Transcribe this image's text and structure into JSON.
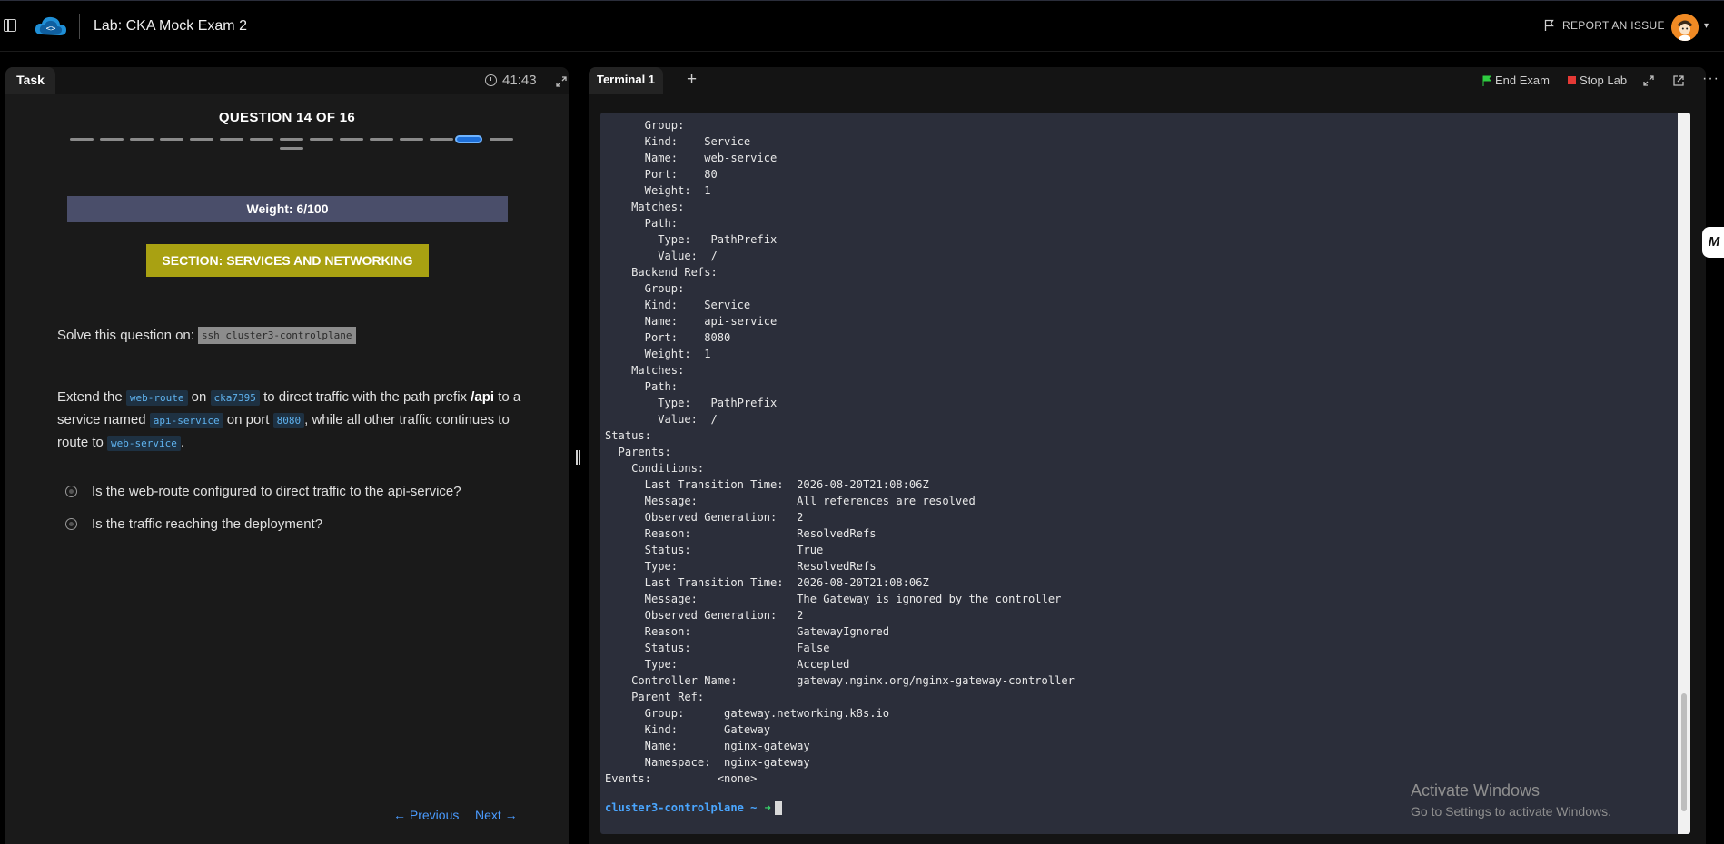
{
  "header": {
    "lab_title": "Lab: CKA Mock Exam 2",
    "report_label": "REPORT AN ISSUE"
  },
  "task_panel": {
    "tab_label": "Task",
    "timer": "41:43",
    "question_title": "QUESTION 14 OF 16",
    "progress": {
      "total": 16,
      "current": 14
    },
    "weight": "Weight: 6/100",
    "section": "SECTION: SERVICES AND NETWORKING",
    "solve_prefix": "Solve this question on:",
    "solve_command": "ssh cluster3-controlplane",
    "desc": {
      "t1": "Extend the",
      "c1": "web-route",
      "t2": "on",
      "c2": "cka7395",
      "t3": "to direct traffic with the path prefix",
      "b1": "/api",
      "t4": "to a service named",
      "c3": "api-service",
      "t5": "on port",
      "c4": "8080",
      "t6": ", while all other traffic continues to route to",
      "c5": "web-service",
      "t7": "."
    },
    "checks": [
      {
        "label": "Is the web-route configured to direct traffic to the api-service?"
      },
      {
        "label": "Is the traffic reaching the deployment?"
      }
    ],
    "prev_label": "← Previous",
    "next_label": "Next →"
  },
  "terminal_panel": {
    "tab_label": "Terminal 1",
    "add_tab_label": "+",
    "end_exam_label": "End Exam",
    "stop_lab_label": "Stop Lab",
    "lines": [
      "      Group:",
      "      Kind:    Service",
      "      Name:    web-service",
      "      Port:    80",
      "      Weight:  1",
      "    Matches:",
      "      Path:",
      "        Type:   PathPrefix",
      "        Value:  /",
      "    Backend Refs:",
      "      Group:",
      "      Kind:    Service",
      "      Name:    api-service",
      "      Port:    8080",
      "      Weight:  1",
      "    Matches:",
      "      Path:",
      "        Type:   PathPrefix",
      "        Value:  /",
      "Status:",
      "  Parents:",
      "    Conditions:",
      "      Last Transition Time:  2026-08-20T21:08:06Z",
      "      Message:               All references are resolved",
      "      Observed Generation:   2",
      "      Reason:                ResolvedRefs",
      "      Status:                True",
      "      Type:                  ResolvedRefs",
      "      Last Transition Time:  2026-08-20T21:08:06Z",
      "      Message:               The Gateway is ignored by the controller",
      "      Observed Generation:   2",
      "      Reason:                GatewayIgnored",
      "      Status:                False",
      "      Type:                  Accepted",
      "    Controller Name:         gateway.nginx.org/nginx-gateway-controller",
      "    Parent Ref:",
      "      Group:      gateway.networking.k8s.io",
      "      Kind:       Gateway",
      "      Name:       nginx-gateway",
      "      Namespace:  nginx-gateway",
      "Events:          <none>"
    ],
    "prompt_host": "cluster3-controlplane ~",
    "prompt_arrow": "➜"
  },
  "side_widget": "M",
  "watermark": {
    "title": "Activate Windows",
    "subtitle": "Go to Settings to activate Windows."
  },
  "colors": {
    "accent_blue": "#4a9bff",
    "section_yellow": "#a9a112",
    "weight_slate": "#4a4e6a",
    "terminal_bg": "#2b2e3a",
    "prompt_green": "#37d36a"
  }
}
